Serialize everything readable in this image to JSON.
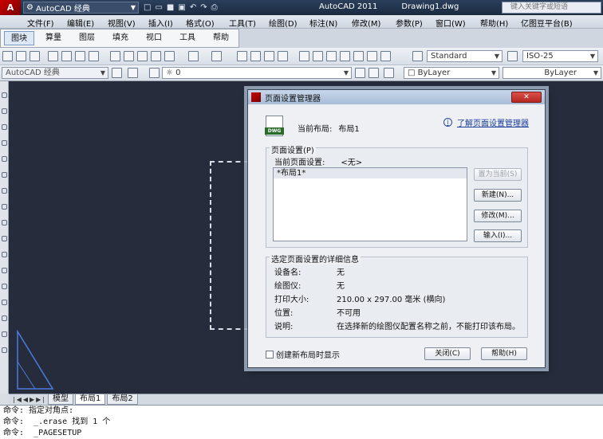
{
  "title_bar": {
    "workspace": "AutoCAD 经典",
    "app_name": "AutoCAD 2011",
    "document": "Drawing1.dwg",
    "search_placeholder": "键入关键字或短语"
  },
  "menu": [
    "文件(F)",
    "编辑(E)",
    "视图(V)",
    "插入(I)",
    "格式(O)",
    "工具(T)",
    "绘图(D)",
    "标注(N)",
    "修改(M)",
    "参数(P)",
    "窗口(W)",
    "帮助(H)",
    "亿图豆平台(B)"
  ],
  "tabs": [
    "图块",
    "算量",
    "图层",
    "填充",
    "视口",
    "工具",
    "帮助"
  ],
  "toolbar": {
    "text_style": "Standard",
    "dim_style": "ISO-25",
    "workspace2": "AutoCAD 经典",
    "layer": "0",
    "color": "ByLayer",
    "linetype": "ByLayer"
  },
  "layout_tabs": [
    "模型",
    "布局1",
    "布局2"
  ],
  "command_lines": [
    "命令: 指定对角点:",
    "命令:  _.erase 找到 1 个",
    "命令:  _PAGESETUP"
  ],
  "dialog": {
    "title": "页面设置管理器",
    "current_layout_label": "当前布局:",
    "current_layout_value": "布局1",
    "help_link": "了解页面设置管理器",
    "page_setup_group": "页面设置(P)",
    "current_setup_label": "当前页面设置:",
    "current_setup_value": "<无>",
    "list_items": [
      "*布局1*"
    ],
    "buttons": {
      "set_current": "置为当前(S)",
      "new": "新建(N)...",
      "modify": "修改(M)...",
      "import": "输入(I)...",
      "close": "关闭(C)",
      "help": "帮助(H)"
    },
    "details_group": "选定页面设置的详细信息",
    "details": [
      {
        "key": "设备名:",
        "value": "无"
      },
      {
        "key": "绘图仪:",
        "value": "无"
      },
      {
        "key": "打印大小:",
        "value": "210.00 x 297.00 毫米 (横向)"
      },
      {
        "key": "位置:",
        "value": "不可用"
      },
      {
        "key": "说明:",
        "value": "在选择新的绘图仪配置名称之前，不能打印该布局。"
      }
    ],
    "checkbox_label": "创建新布局时显示",
    "dwg_icon_label": "DWG"
  }
}
